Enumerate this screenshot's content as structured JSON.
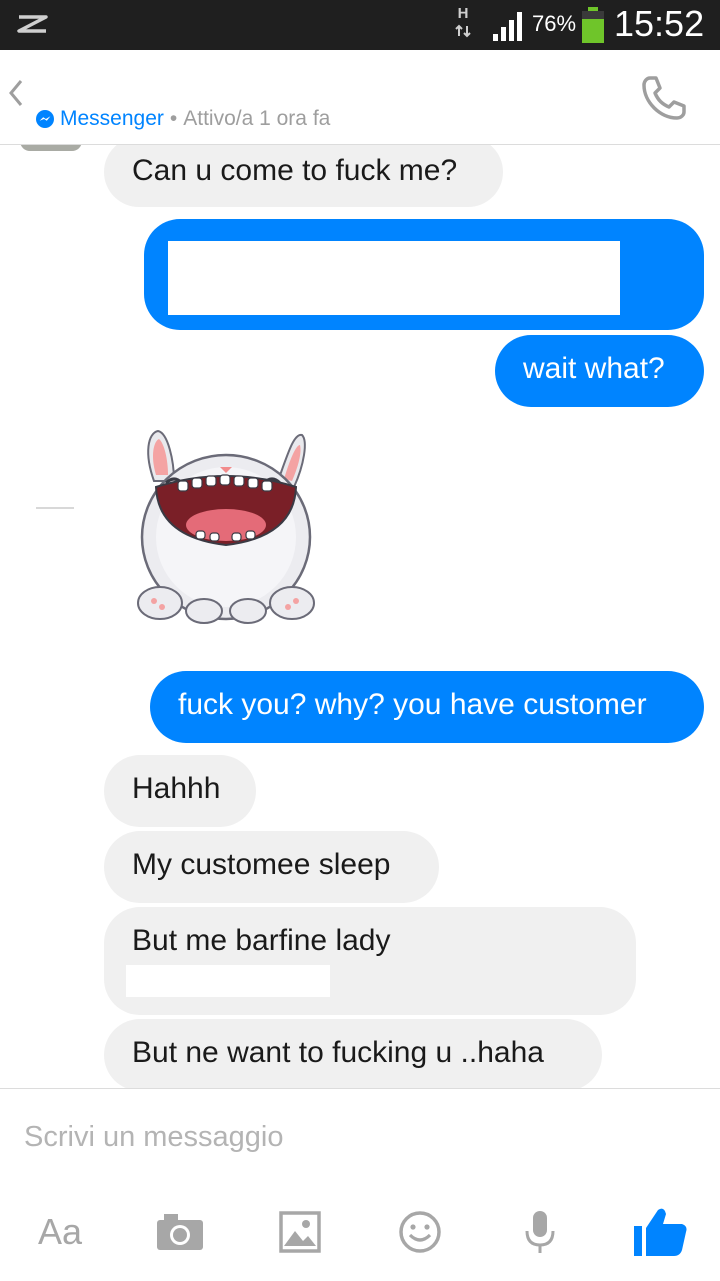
{
  "status_bar": {
    "network_indicator": "H",
    "battery_percent": "76%",
    "time": "15:52",
    "icons": [
      "z-notification-icon",
      "h-network-icon",
      "signal-icon",
      "battery-icon"
    ]
  },
  "header": {
    "back_icon": "chevron-left-icon",
    "app_label": "Messenger",
    "separator": "•",
    "status": "Attivo/a 1 ora fa",
    "call_icon": "phone-icon"
  },
  "messages": [
    {
      "direction": "in",
      "text": "Can u come to fuck me?"
    },
    {
      "direction": "out",
      "text": "",
      "redacted": true
    },
    {
      "direction": "out",
      "text": "wait what?"
    },
    {
      "direction": "in",
      "sticker": "laughing-bunny-sticker"
    },
    {
      "direction": "out",
      "text": "fuck you? why? you have customer"
    },
    {
      "direction": "in",
      "text": "Hahhh"
    },
    {
      "direction": "in",
      "text": "My customee sleep"
    },
    {
      "direction": "in",
      "text": "But me barfine lady",
      "partially_redacted": true
    },
    {
      "direction": "in",
      "text": "But ne want to fucking u ..haha"
    }
  ],
  "composer": {
    "placeholder": "Scrivi un messaggio",
    "toolbar": {
      "text_button_label": "Aa",
      "icons": [
        "camera-icon",
        "gallery-icon",
        "emoji-icon",
        "microphone-icon",
        "like-icon"
      ]
    }
  },
  "colors": {
    "accent": "#0084ff",
    "incoming_bubble": "#f0f0f0",
    "status_bar": "#1f1f1f",
    "muted_text": "#9e9e9e",
    "icon_gray": "#a7a7a7",
    "battery_green": "#6fc52a"
  }
}
